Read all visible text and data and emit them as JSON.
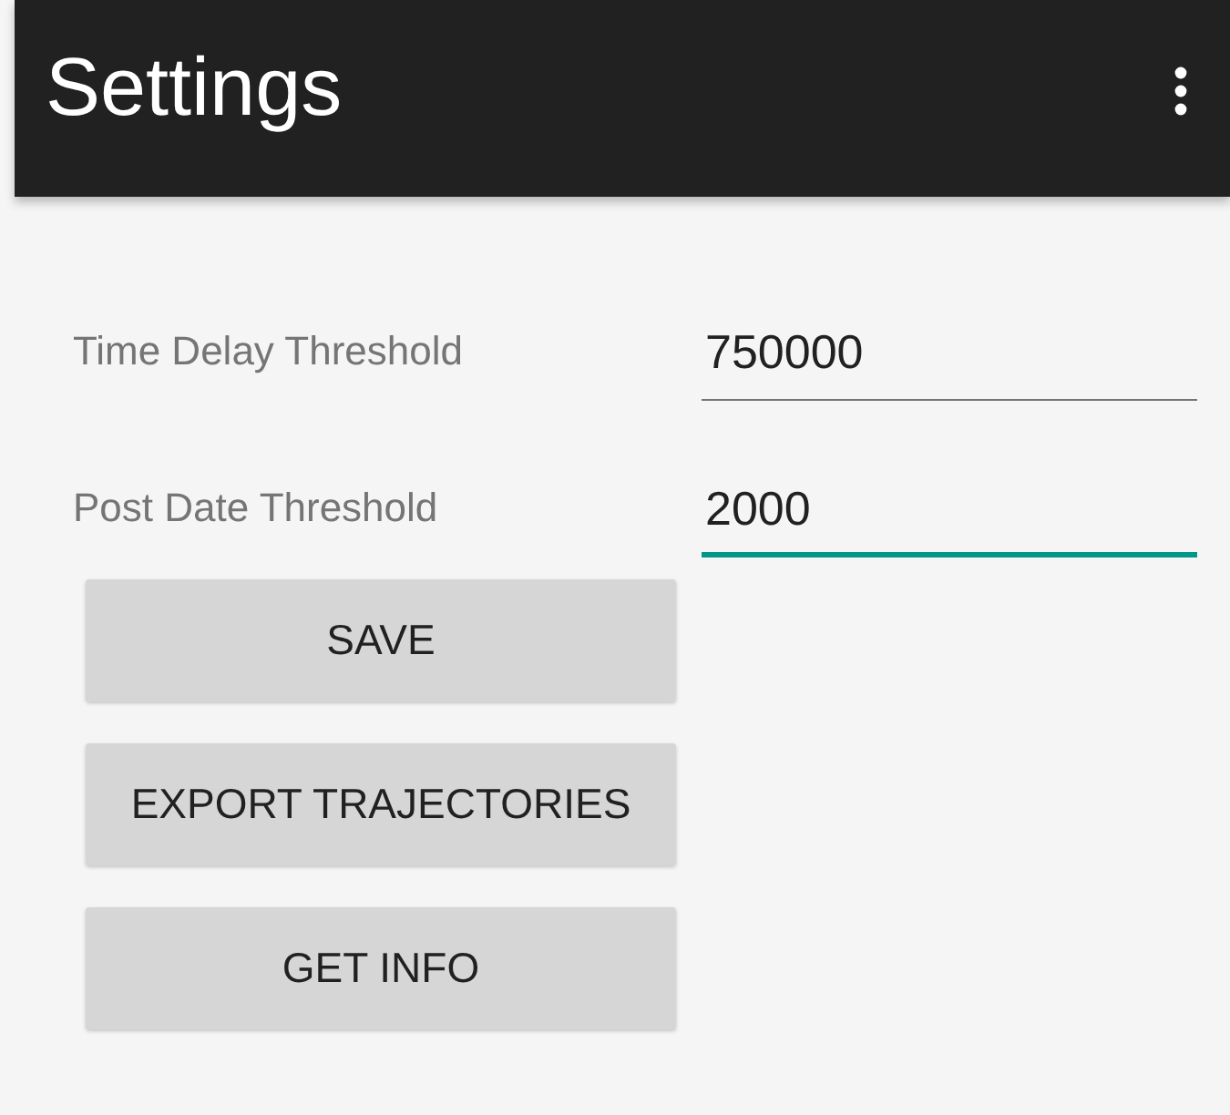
{
  "app_bar": {
    "title": "Settings"
  },
  "fields": [
    {
      "label": "Time Delay Threshold",
      "value": "750000",
      "focused": false
    },
    {
      "label": "Post Date Threshold",
      "value": "2000",
      "focused": true
    }
  ],
  "buttons": [
    "SAVE",
    "EXPORT TRAJECTORIES",
    "GET INFO"
  ]
}
